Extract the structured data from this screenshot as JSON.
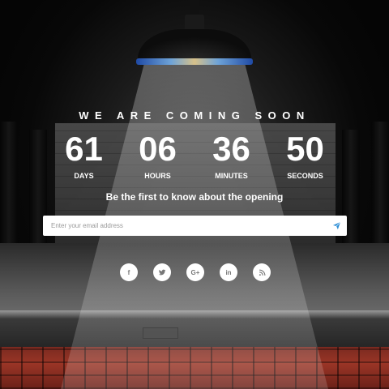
{
  "headline": "WE ARE COMING SOON",
  "countdown": [
    {
      "value": "61",
      "label": "DAYS"
    },
    {
      "value": "06",
      "label": "HOURS"
    },
    {
      "value": "36",
      "label": "MINUTES"
    },
    {
      "value": "50",
      "label": "SECONDS"
    }
  ],
  "subheadline": "Be the first to know about the opening",
  "subscribe": {
    "placeholder": "Enter your email address",
    "send_icon": "paper-plane-icon"
  },
  "social": [
    {
      "icon": "facebook-icon",
      "glyph": "f"
    },
    {
      "icon": "twitter-icon",
      "glyph": "t"
    },
    {
      "icon": "google-plus-icon",
      "glyph": "G+"
    },
    {
      "icon": "linkedin-icon",
      "glyph": "in"
    },
    {
      "icon": "rss-icon",
      "glyph": "rss"
    }
  ],
  "colors": {
    "accent": "#2f8fd6",
    "seats": "#8a2f22",
    "text": "#ffffff"
  }
}
